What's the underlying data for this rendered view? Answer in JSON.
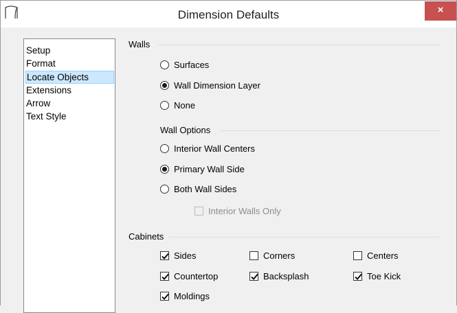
{
  "window": {
    "title": "Dimension Defaults",
    "close_glyph": "×"
  },
  "sidebar": {
    "items": [
      {
        "label": "Setup"
      },
      {
        "label": "Format"
      },
      {
        "label": "Locate Objects",
        "selected": true
      },
      {
        "label": "Extensions"
      },
      {
        "label": "Arrow"
      },
      {
        "label": "Text Style"
      }
    ]
  },
  "walls": {
    "label": "Walls",
    "options": [
      {
        "label": "Surfaces",
        "checked": false
      },
      {
        "label": "Wall Dimension Layer",
        "checked": true
      },
      {
        "label": "None",
        "checked": false
      }
    ]
  },
  "wall_options": {
    "label": "Wall Options",
    "options": [
      {
        "label": "Interior Wall Centers",
        "checked": false
      },
      {
        "label": "Primary Wall Side",
        "checked": true
      },
      {
        "label": "Both Wall Sides",
        "checked": false
      }
    ],
    "interior_walls_only": {
      "label": "Interior Walls Only",
      "checked": false,
      "disabled": true
    }
  },
  "cabinets": {
    "label": "Cabinets",
    "checks": [
      {
        "label": "Sides",
        "checked": true
      },
      {
        "label": "Corners",
        "checked": false
      },
      {
        "label": "Centers",
        "checked": false
      },
      {
        "label": "Countertop",
        "checked": true
      },
      {
        "label": "Backsplash",
        "checked": true
      },
      {
        "label": "Toe Kick",
        "checked": true
      },
      {
        "label": "Moldings",
        "checked": true
      }
    ]
  },
  "colors": {
    "selection_bg": "#cce8ff",
    "close_bg": "#c75050"
  }
}
